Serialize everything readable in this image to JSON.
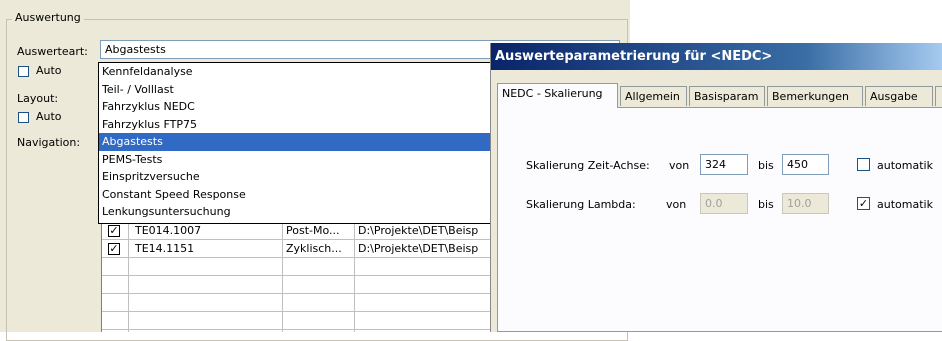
{
  "main": {
    "group_title": "Auswertung",
    "auswerteart_label": "Auswerteart:",
    "auswerteart_value": "Abgastests",
    "auto1_label": "Auto",
    "layout_label": "Layout:",
    "auto2_label": "Auto",
    "navigation_label": "Navigation:",
    "dropdown_options": [
      "Kennfeldanalyse",
      "Teil- / Volllast",
      "Fahrzyklus NEDC",
      "Fahrzyklus FTP75",
      "Abgastests",
      "PEMS-Tests",
      "Einspritzversuche",
      "Constant Speed Response",
      "Lenkungsuntersuchung"
    ],
    "rows": [
      {
        "name": "TE014.1007",
        "type": "Post-Mo...",
        "path": "D:\\Projekte\\DET\\Beisp",
        "checked": true
      },
      {
        "name": "TE14.1151",
        "type": "Zyklisch...",
        "path": "D:\\Projekte\\DET\\Beisp",
        "checked": true
      }
    ]
  },
  "dialog": {
    "title": "Auswerteparametrierung für <NEDC>",
    "tabs": [
      "NEDC - Skalierung",
      "Allgemein",
      "Basisparam",
      "Bemerkungen",
      "Ausgabe"
    ],
    "zeit_label": "Skalierung Zeit-Achse:",
    "von_label": "von",
    "bis_label": "bis",
    "zeit_von": "324",
    "zeit_bis": "450",
    "lambda_label": "Skalierung Lambda:",
    "lambda_von": "0.0",
    "lambda_bis": "10.0",
    "automatik_label": "automatik",
    "zeit_automatik_checked": false,
    "lambda_automatik_checked": true
  }
}
